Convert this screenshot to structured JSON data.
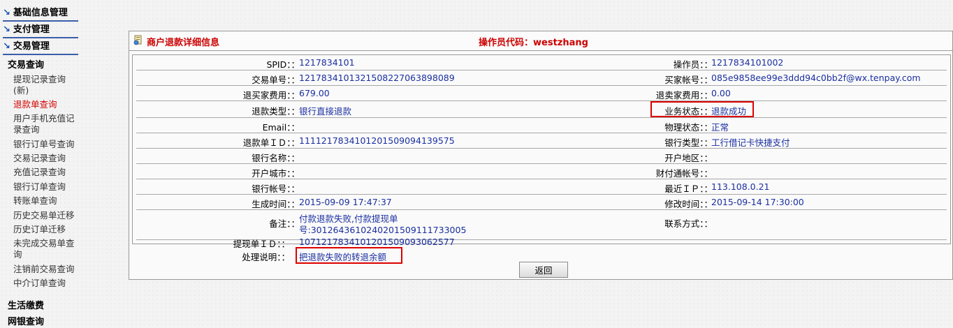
{
  "sidebar": {
    "sections": [
      "基础信息管理",
      "支付管理",
      "交易管理"
    ],
    "sub_heading": "交易查询",
    "items": [
      "提现记录查询(新)",
      "退款单查询",
      "用户手机充值记录查询",
      "银行订单号查询",
      "交易记录查询",
      "充值记录查询",
      "银行订单查询",
      "转账单查询",
      "历史交易单迁移",
      "历史订单迁移",
      "未完成交易单查询",
      "注销前交易查询",
      "中介订单查询"
    ],
    "bottom": [
      "生活缴费",
      "网银查询"
    ]
  },
  "panel": {
    "title": "商户退款详细信息",
    "operator": "操作员代码：westzhang",
    "rows": [
      {
        "l1": "SPID：：",
        "v1": "1217834101",
        "l2": "操作员：：",
        "v2": "1217834101002"
      },
      {
        "l1": "交易单号：：",
        "v1": "1217834101321508227063898089",
        "l2": "买家帐号：：",
        "v2": "085e9858ee99e3ddd94c0bb2f@wx.tenpay.com"
      },
      {
        "l1": "退买家费用：：",
        "v1": "679.00",
        "l2": "退卖家费用：：",
        "v2": "0.00"
      },
      {
        "l1": "退款类型：：",
        "v1": "银行直接退款",
        "l2": "业务状态：：",
        "v2": "退款成功"
      },
      {
        "l1": "Email：：",
        "v1": "",
        "l2": "物理状态：：",
        "v2": "正常"
      },
      {
        "l1": "退款单ＩＤ：：",
        "v1": "1111217834101201509094139575",
        "l2": "银行类型：：",
        "v2": "工行借记卡快捷支付"
      },
      {
        "l1": "银行名称：：",
        "v1": "",
        "l2": "开户地区：：",
        "v2": ""
      },
      {
        "l1": "开户城市：：",
        "v1": "",
        "l2": "财付通帐号：：",
        "v2": ""
      },
      {
        "l1": "银行帐号：：",
        "v1": "",
        "l2": "最近ＩＰ：：",
        "v2": "113.108.0.21"
      },
      {
        "l1": "生成时间：：",
        "v1": "2015-09-09 17:47:37",
        "l2": "修改时间：：",
        "v2": "2015-09-14 17:30:00"
      }
    ],
    "remark": {
      "label": "备注：：",
      "line1": "付款退款失败,付款提现单",
      "line2": "号:3012643610240201509111733005",
      "contact_label": "联系方式：："
    },
    "withdraw": {
      "label": "提现单ＩＤ：：",
      "value": "1071217834101201509093062577"
    },
    "handle": {
      "label": "处理说明：：",
      "value": "把退款失败的转退余额"
    },
    "back_label": "返回"
  }
}
